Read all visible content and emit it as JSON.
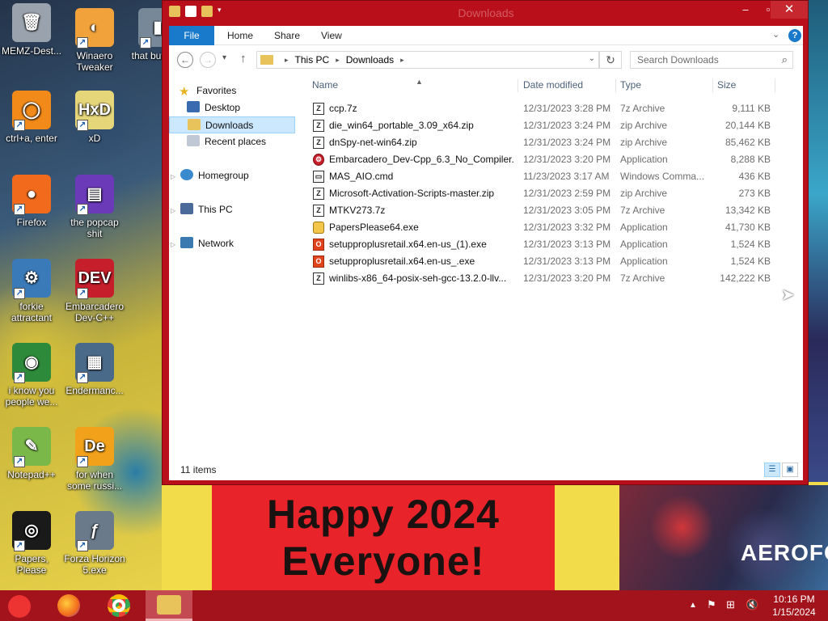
{
  "desktop": {
    "banner": {
      "line1": "Happy 2024",
      "line2": "Everyone!"
    },
    "bg_logo": "AEROFOS",
    "icons": [
      {
        "label": "MEMZ-Dest...",
        "icon": "recycle-bin-icon",
        "color": "#9aa3ad",
        "glyph": "🗑",
        "shortcut": false
      },
      {
        "label": "Winaero Tweaker",
        "icon": "winaero-tweaker-icon",
        "color": "#f2a23a",
        "glyph": "◐",
        "shortcut": true
      },
      {
        "label": "that but its c",
        "icon": "app-shortcut-icon",
        "color": "#778899",
        "glyph": "▮",
        "shortcut": true
      },
      {
        "label": "ctrl+a, enter",
        "icon": "orange-ring-icon",
        "color": "#f28a1a",
        "glyph": "◯",
        "shortcut": true
      },
      {
        "label": "xD",
        "icon": "hxd-icon",
        "color": "#e6d67a",
        "glyph": "HxD",
        "shortcut": true
      },
      {
        "label": "Firefox",
        "icon": "firefox-icon",
        "color": "#f26b1d",
        "glyph": "●",
        "shortcut": true
      },
      {
        "label": "the popcap shit",
        "icon": "popcap-icon",
        "color": "#6a3ab8",
        "glyph": "▤",
        "shortcut": true
      },
      {
        "label": "forkie attractant",
        "icon": "settings-monitor-icon",
        "color": "#3a7ab8",
        "glyph": "⚙",
        "shortcut": true
      },
      {
        "label": "Embarcadero Dev-C++",
        "icon": "devcpp-icon",
        "color": "#c71e2b",
        "glyph": "DEV",
        "shortcut": true
      },
      {
        "label": "i know you people we...",
        "icon": "chrome-icon",
        "color": "#2d8a3a",
        "glyph": "◉",
        "shortcut": true
      },
      {
        "label": "Endermanc...",
        "icon": "window-app-icon",
        "color": "#4a6a8a",
        "glyph": "▦",
        "shortcut": true
      },
      {
        "label": "Notepad++",
        "icon": "notepadpp-icon",
        "color": "#7ab84a",
        "glyph": "✎",
        "shortcut": true
      },
      {
        "label": "for when some russi...",
        "icon": "de-icon",
        "color": "#f2a21a",
        "glyph": "De",
        "shortcut": true
      },
      {
        "label": "Papers, Please",
        "icon": "papers-please-icon",
        "color": "#1a1a1a",
        "glyph": "◎",
        "shortcut": true
      },
      {
        "label": "Forza Horizon 5.exe",
        "icon": "flash-icon",
        "color": "#6a7a8a",
        "glyph": "ƒ",
        "shortcut": true
      }
    ]
  },
  "window": {
    "title": "Downloads",
    "tabs": [
      "File",
      "Home",
      "Share",
      "View"
    ],
    "breadcrumb": [
      "This PC",
      "Downloads"
    ],
    "search_placeholder": "Search Downloads",
    "nav": {
      "favorites": "Favorites",
      "fav_items": [
        "Desktop",
        "Downloads",
        "Recent places"
      ],
      "homegroup": "Homegroup",
      "thispc": "This PC",
      "network": "Network"
    },
    "columns": {
      "name": "Name",
      "date": "Date modified",
      "type": "Type",
      "size": "Size"
    },
    "files": [
      {
        "name": "ccp.7z",
        "date": "12/31/2023 3:28 PM",
        "type": "7z Archive",
        "size": "9,111 KB",
        "icon": "z"
      },
      {
        "name": "die_win64_portable_3.09_x64.zip",
        "date": "12/31/2023 3:24 PM",
        "type": "zip Archive",
        "size": "20,144 KB",
        "icon": "z"
      },
      {
        "name": "dnSpy-net-win64.zip",
        "date": "12/31/2023 3:24 PM",
        "type": "zip Archive",
        "size": "85,462 KB",
        "icon": "z"
      },
      {
        "name": "Embarcadero_Dev-Cpp_6.3_No_Compiler...",
        "date": "12/31/2023 3:20 PM",
        "type": "Application",
        "size": "8,288 KB",
        "icon": "app"
      },
      {
        "name": "MAS_AIO.cmd",
        "date": "11/23/2023 3:17 AM",
        "type": "Windows Comma...",
        "size": "436 KB",
        "icon": "cmd"
      },
      {
        "name": "Microsoft-Activation-Scripts-master.zip",
        "date": "12/31/2023 2:59 PM",
        "type": "zip Archive",
        "size": "273 KB",
        "icon": "z"
      },
      {
        "name": "MTKV273.7z",
        "date": "12/31/2023 3:05 PM",
        "type": "7z Archive",
        "size": "13,342 KB",
        "icon": "z"
      },
      {
        "name": "PapersPlease64.exe",
        "date": "12/31/2023 3:32 PM",
        "type": "Application",
        "size": "41,730 KB",
        "icon": "paper"
      },
      {
        "name": "setupproplusretail.x64.en-us_(1).exe",
        "date": "12/31/2023 3:13 PM",
        "type": "Application",
        "size": "1,524 KB",
        "icon": "office"
      },
      {
        "name": "setupproplusretail.x64.en-us_.exe",
        "date": "12/31/2023 3:13 PM",
        "type": "Application",
        "size": "1,524 KB",
        "icon": "office"
      },
      {
        "name": "winlibs-x86_64-posix-seh-gcc-13.2.0-llv...",
        "date": "12/31/2023 3:20 PM",
        "type": "7z Archive",
        "size": "142,222 KB",
        "icon": "z"
      }
    ],
    "status": "11 items"
  },
  "taskbar": {
    "time": "10:16 PM",
    "date": "1/15/2024",
    "apps": [
      "firefox",
      "chrome",
      "file-explorer"
    ]
  },
  "colors": {
    "window_frame": "#b80f1a",
    "taskbar": "#a3131c",
    "accent": "#1979ca"
  }
}
